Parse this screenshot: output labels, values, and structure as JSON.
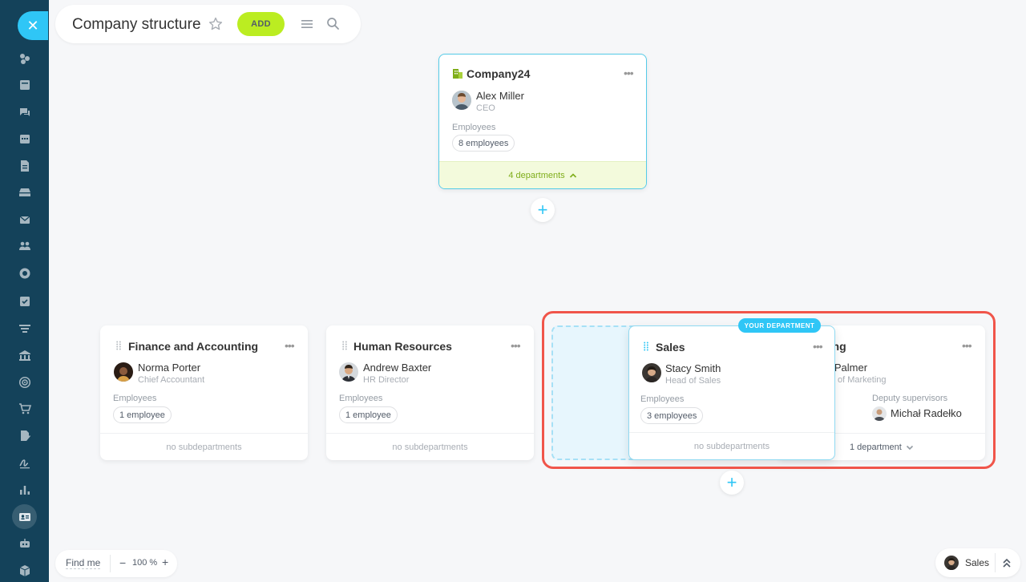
{
  "header": {
    "title": "Company structure",
    "add_label": "ADD"
  },
  "sidebar": {
    "icons": [
      "activity-stream-icon",
      "feed-icon",
      "chat-icon",
      "calendar-icon",
      "documents-icon",
      "drive-icon",
      "mail-icon",
      "groups-icon",
      "workgroups-icon",
      "tasks-icon",
      "crm-icon",
      "company-icon",
      "marketing-icon",
      "shop-icon",
      "sign-icon",
      "esign-icon",
      "reports-icon",
      "employees-icon",
      "automation-icon",
      "apps-icon"
    ]
  },
  "root": {
    "name": "Company24",
    "head_name": "Alex Miller",
    "head_role": "CEO",
    "employees_label": "Employees",
    "employees_count": "8 employees",
    "footer": "4 departments"
  },
  "departments": [
    {
      "name": "Finance and Accounting",
      "head_name": "Norma Porter",
      "head_role": "Chief Accountant",
      "employees_label": "Employees",
      "employees_count": "1 employee",
      "footer": "no subdepartments"
    },
    {
      "name": "Human Resources",
      "head_name": "Andrew Baxter",
      "head_role": "HR Director",
      "employees_label": "Employees",
      "employees_count": "1 employee",
      "footer": "no subdepartments"
    },
    {
      "name": "Sales",
      "badge": "YOUR DEPARTMENT",
      "head_name": "Stacy Smith",
      "head_role": "Head of Sales",
      "employees_label": "Employees",
      "employees_count": "3 employees",
      "footer": "no subdepartments"
    },
    {
      "name_visible": "ting",
      "head_name_visible": "e Palmer",
      "head_role_visible": "of Marketing",
      "employees_count_visible": "es",
      "deputy_label": "Deputy supervisors",
      "deputy_name": "Michał Radełko",
      "footer": "1 department"
    }
  ],
  "bottom": {
    "find_me": "Find me",
    "zoom_minus": "−",
    "zoom_value": "100 %",
    "zoom_plus": "+",
    "current_dept": "Sales"
  },
  "colors": {
    "sidebar": "#14425a",
    "accent": "#2fc6f6",
    "add_button": "#bbed21",
    "highlight_outline": "#f0554a",
    "root_footer": "#f3fadc",
    "root_accent": "#7fad1a"
  }
}
